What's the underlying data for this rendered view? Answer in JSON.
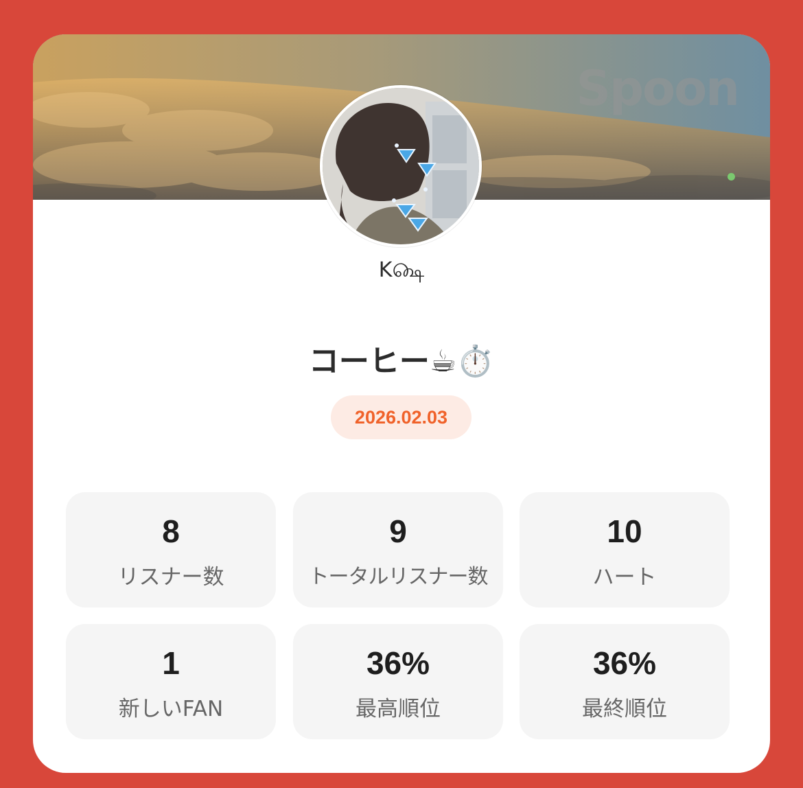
{
  "banner": {
    "watermark": "Spoon"
  },
  "profile": {
    "username": "K௸",
    "live_title": "コーヒー☕⏱️",
    "date": "2026.02.03"
  },
  "colors": {
    "background": "#d8473a",
    "accent": "#f0622a",
    "badge_bg": "#fdebe4",
    "tile_bg": "#f5f5f5"
  },
  "stats": [
    {
      "value": "8",
      "label": "リスナー数"
    },
    {
      "value": "9",
      "label": "トータルリスナー数"
    },
    {
      "value": "10",
      "label": "ハート"
    },
    {
      "value": "1",
      "label": "新しいFAN"
    },
    {
      "value": "36%",
      "label": "最高順位"
    },
    {
      "value": "36%",
      "label": "最終順位"
    }
  ]
}
